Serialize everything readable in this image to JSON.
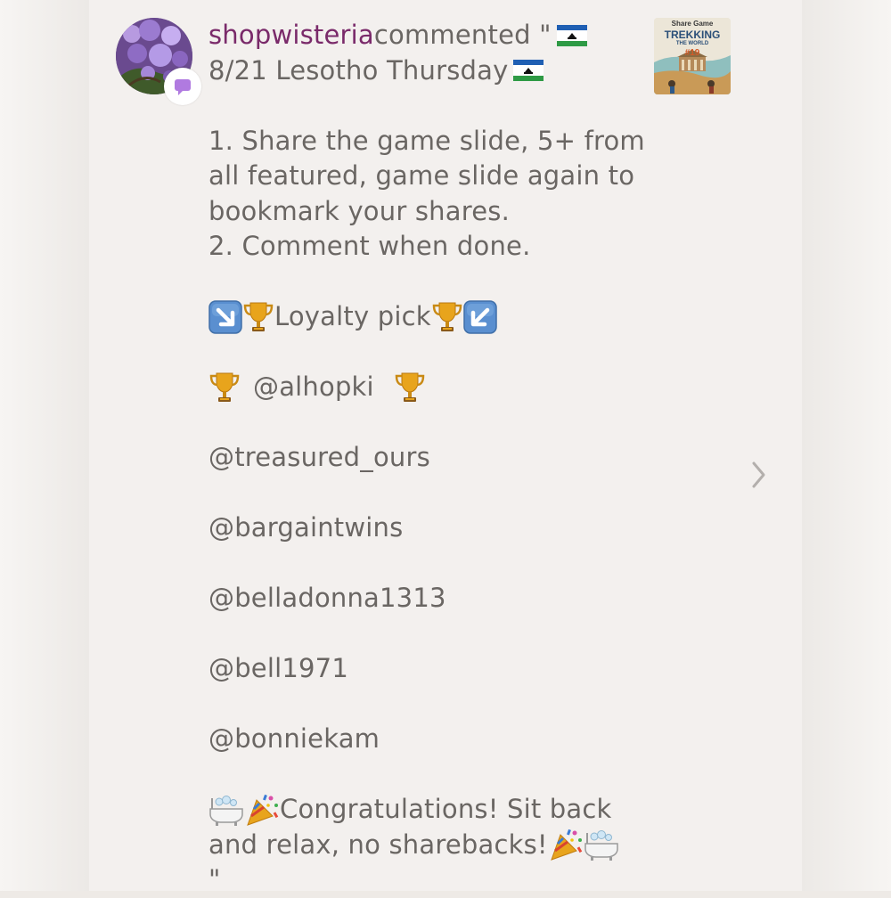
{
  "comment": {
    "username": "shopwisteria",
    "action": " commented \"",
    "date_line": "8/21 Lesotho Thursday ",
    "rules": [
      "1. Share the game slide, 5+ from",
      "all featured, game slide again to",
      "bookmark your shares.",
      "2. Comment when done."
    ],
    "loyalty_label": "Loyalty pick",
    "winner": "@alhopki",
    "mentions": [
      "@treasured_ours",
      "@bargaintwins",
      "@belladonna1313",
      "@bell1971",
      "@bonniekam"
    ],
    "closing_line1": " Congratulations! Sit back",
    "closing_line2": "and relax, no sharebacks! ",
    "closing_quote": "\""
  },
  "thumbnail": {
    "line1": "Share Game",
    "line2": "TREKKING",
    "line3": "THE WORLD",
    "line4": "#19"
  },
  "icons": {
    "avatar": "wisteria-photo",
    "badge": "comment-bubble-icon",
    "flag": "lesotho-flag-icon",
    "trophy": "trophy-icon",
    "arrow_down_right": "arrow-down-right-icon",
    "arrow_down_left": "arrow-down-left-icon",
    "bathtub": "bathtub-icon",
    "party": "party-popper-icon",
    "next": "chevron-right-icon"
  },
  "colors": {
    "username": "#7a2a6a",
    "text": "#6a6663",
    "badge_icon": "#b07ae0",
    "background": "#f3f0ee"
  }
}
